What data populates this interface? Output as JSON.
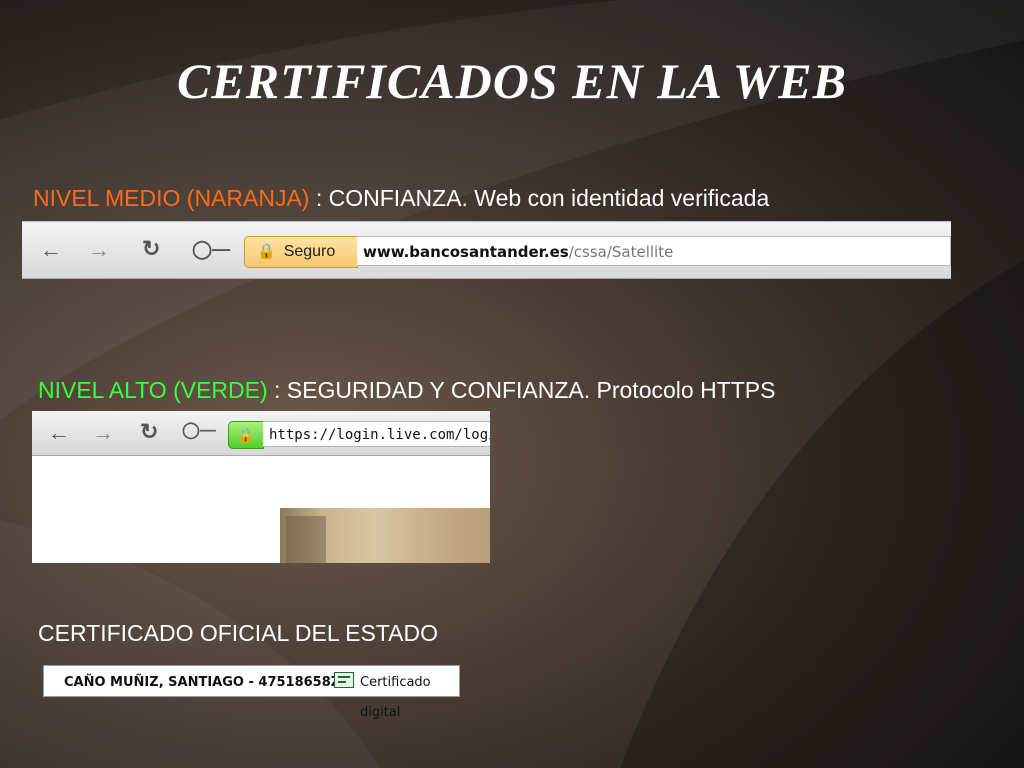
{
  "slide": {
    "title": "CERTIFICADOS EN LA WEB"
  },
  "level_medium": {
    "highlight": "NIVEL MEDIO (NARANJA)",
    "rest": " : CONFIANZA. Web con identidad verificada",
    "highlight_color": "#ff6a1a",
    "browser": {
      "back_icon": "back-arrow-icon",
      "forward_icon": "forward-arrow-icon",
      "reload_icon": "reload-icon",
      "key_icon": "key-icon",
      "badge_label": "Seguro",
      "badge_color": "#f6c870",
      "url_domain": "www.bancosantander.es",
      "url_path": "/cssa/Satellite"
    }
  },
  "level_high": {
    "highlight": "NIVEL ALTO (VERDE)",
    "rest": " : SEGURIDAD Y CONFIANZA. Protocolo HTTPS",
    "highlight_color": "#3cff3c",
    "browser": {
      "back_icon": "back-arrow-icon",
      "forward_icon": "forward-arrow-icon",
      "reload_icon": "reload-icon",
      "key_icon": "key-icon",
      "badge_icon": "lock-icon",
      "badge_color": "#4fcf2a",
      "url": "https://login.live.com/login.sr"
    }
  },
  "official": {
    "heading": "CERTIFICADO OFICIAL DEL ESTADO",
    "cert_owner": "CAÑO MUÑIZ, SANTIAGO - 47518658Z",
    "cert_label": "Certificado digital"
  }
}
